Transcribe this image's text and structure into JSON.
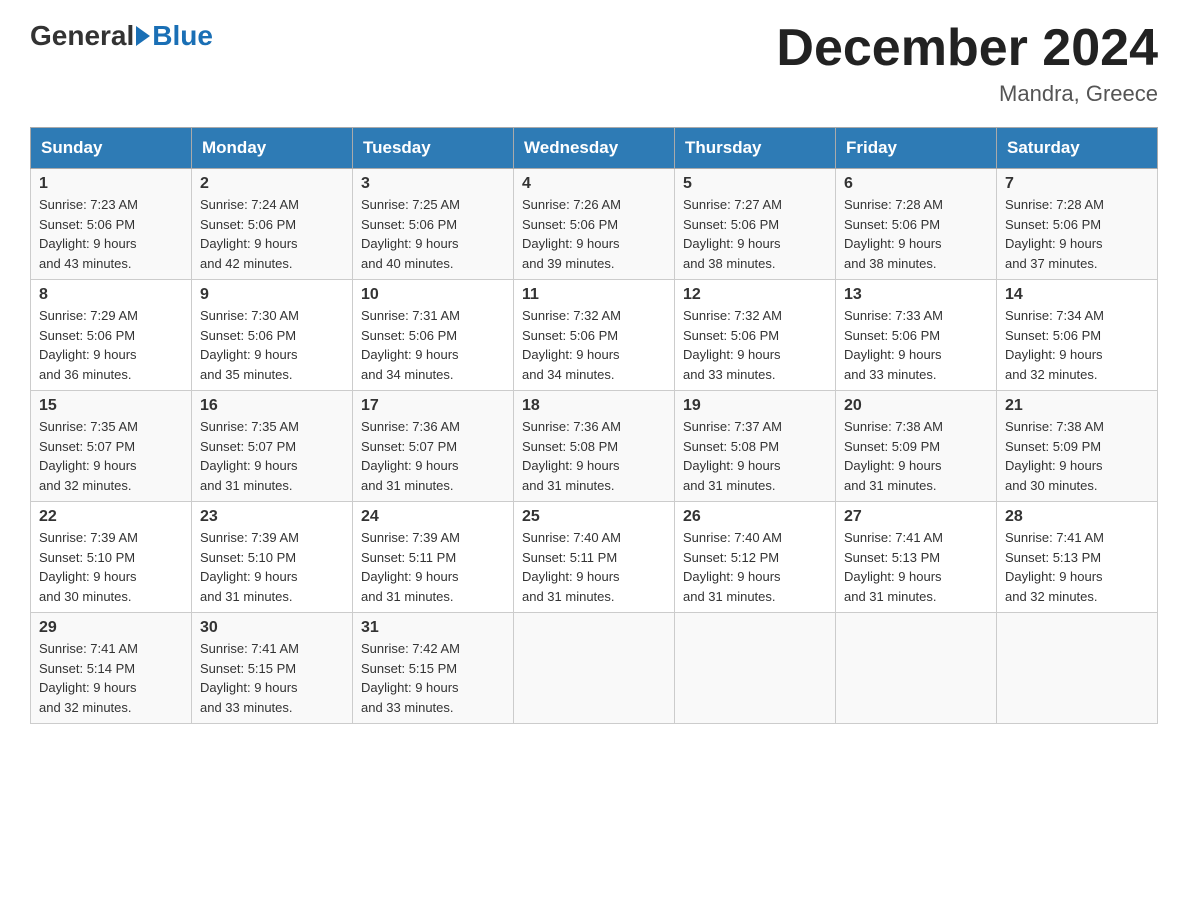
{
  "header": {
    "logo_general": "General",
    "logo_blue": "Blue",
    "month_title": "December 2024",
    "location": "Mandra, Greece"
  },
  "weekdays": [
    "Sunday",
    "Monday",
    "Tuesday",
    "Wednesday",
    "Thursday",
    "Friday",
    "Saturday"
  ],
  "weeks": [
    [
      {
        "day": "1",
        "sunrise": "7:23 AM",
        "sunset": "5:06 PM",
        "daylight": "9 hours and 43 minutes."
      },
      {
        "day": "2",
        "sunrise": "7:24 AM",
        "sunset": "5:06 PM",
        "daylight": "9 hours and 42 minutes."
      },
      {
        "day": "3",
        "sunrise": "7:25 AM",
        "sunset": "5:06 PM",
        "daylight": "9 hours and 40 minutes."
      },
      {
        "day": "4",
        "sunrise": "7:26 AM",
        "sunset": "5:06 PM",
        "daylight": "9 hours and 39 minutes."
      },
      {
        "day": "5",
        "sunrise": "7:27 AM",
        "sunset": "5:06 PM",
        "daylight": "9 hours and 38 minutes."
      },
      {
        "day": "6",
        "sunrise": "7:28 AM",
        "sunset": "5:06 PM",
        "daylight": "9 hours and 38 minutes."
      },
      {
        "day": "7",
        "sunrise": "7:28 AM",
        "sunset": "5:06 PM",
        "daylight": "9 hours and 37 minutes."
      }
    ],
    [
      {
        "day": "8",
        "sunrise": "7:29 AM",
        "sunset": "5:06 PM",
        "daylight": "9 hours and 36 minutes."
      },
      {
        "day": "9",
        "sunrise": "7:30 AM",
        "sunset": "5:06 PM",
        "daylight": "9 hours and 35 minutes."
      },
      {
        "day": "10",
        "sunrise": "7:31 AM",
        "sunset": "5:06 PM",
        "daylight": "9 hours and 34 minutes."
      },
      {
        "day": "11",
        "sunrise": "7:32 AM",
        "sunset": "5:06 PM",
        "daylight": "9 hours and 34 minutes."
      },
      {
        "day": "12",
        "sunrise": "7:32 AM",
        "sunset": "5:06 PM",
        "daylight": "9 hours and 33 minutes."
      },
      {
        "day": "13",
        "sunrise": "7:33 AM",
        "sunset": "5:06 PM",
        "daylight": "9 hours and 33 minutes."
      },
      {
        "day": "14",
        "sunrise": "7:34 AM",
        "sunset": "5:06 PM",
        "daylight": "9 hours and 32 minutes."
      }
    ],
    [
      {
        "day": "15",
        "sunrise": "7:35 AM",
        "sunset": "5:07 PM",
        "daylight": "9 hours and 32 minutes."
      },
      {
        "day": "16",
        "sunrise": "7:35 AM",
        "sunset": "5:07 PM",
        "daylight": "9 hours and 31 minutes."
      },
      {
        "day": "17",
        "sunrise": "7:36 AM",
        "sunset": "5:07 PM",
        "daylight": "9 hours and 31 minutes."
      },
      {
        "day": "18",
        "sunrise": "7:36 AM",
        "sunset": "5:08 PM",
        "daylight": "9 hours and 31 minutes."
      },
      {
        "day": "19",
        "sunrise": "7:37 AM",
        "sunset": "5:08 PM",
        "daylight": "9 hours and 31 minutes."
      },
      {
        "day": "20",
        "sunrise": "7:38 AM",
        "sunset": "5:09 PM",
        "daylight": "9 hours and 31 minutes."
      },
      {
        "day": "21",
        "sunrise": "7:38 AM",
        "sunset": "5:09 PM",
        "daylight": "9 hours and 30 minutes."
      }
    ],
    [
      {
        "day": "22",
        "sunrise": "7:39 AM",
        "sunset": "5:10 PM",
        "daylight": "9 hours and 30 minutes."
      },
      {
        "day": "23",
        "sunrise": "7:39 AM",
        "sunset": "5:10 PM",
        "daylight": "9 hours and 31 minutes."
      },
      {
        "day": "24",
        "sunrise": "7:39 AM",
        "sunset": "5:11 PM",
        "daylight": "9 hours and 31 minutes."
      },
      {
        "day": "25",
        "sunrise": "7:40 AM",
        "sunset": "5:11 PM",
        "daylight": "9 hours and 31 minutes."
      },
      {
        "day": "26",
        "sunrise": "7:40 AM",
        "sunset": "5:12 PM",
        "daylight": "9 hours and 31 minutes."
      },
      {
        "day": "27",
        "sunrise": "7:41 AM",
        "sunset": "5:13 PM",
        "daylight": "9 hours and 31 minutes."
      },
      {
        "day": "28",
        "sunrise": "7:41 AM",
        "sunset": "5:13 PM",
        "daylight": "9 hours and 32 minutes."
      }
    ],
    [
      {
        "day": "29",
        "sunrise": "7:41 AM",
        "sunset": "5:14 PM",
        "daylight": "9 hours and 32 minutes."
      },
      {
        "day": "30",
        "sunrise": "7:41 AM",
        "sunset": "5:15 PM",
        "daylight": "9 hours and 33 minutes."
      },
      {
        "day": "31",
        "sunrise": "7:42 AM",
        "sunset": "5:15 PM",
        "daylight": "9 hours and 33 minutes."
      },
      null,
      null,
      null,
      null
    ]
  ],
  "labels": {
    "sunrise": "Sunrise:",
    "sunset": "Sunset:",
    "daylight": "Daylight:"
  }
}
